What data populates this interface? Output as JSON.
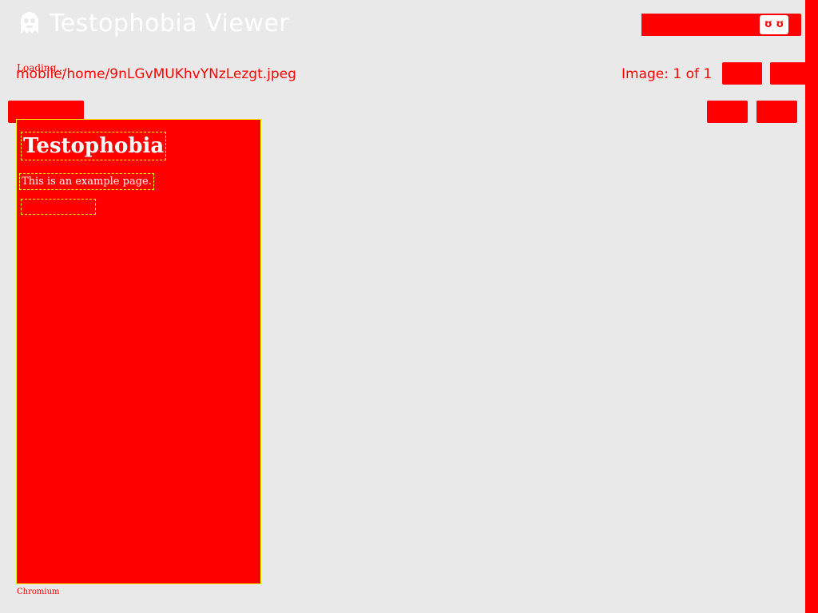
{
  "header": {
    "title": "Testophobia Viewer",
    "logo_icon": "ghost-icon",
    "select_value": "",
    "reload_label": "ʊ ʊ"
  },
  "status": {
    "loading": "Loading..."
  },
  "file": {
    "path": "mobile/home/9nLGvMUKhvYNzLezgt.jpeg"
  },
  "counter": {
    "label": "Image: 1 of 1"
  },
  "controls": {
    "prev_label": "",
    "next_label": "",
    "view_select_value": "",
    "zoom_out_label": "",
    "zoom_in_label": ""
  },
  "preview": {
    "heading": "Testophobia",
    "paragraph": "This is an example page.",
    "link": "",
    "caption": "Chromium"
  },
  "colors": {
    "background": "#e9e9e9",
    "highlight": "#ff0000",
    "outline": "#ffff00",
    "title": "#ffffff"
  }
}
